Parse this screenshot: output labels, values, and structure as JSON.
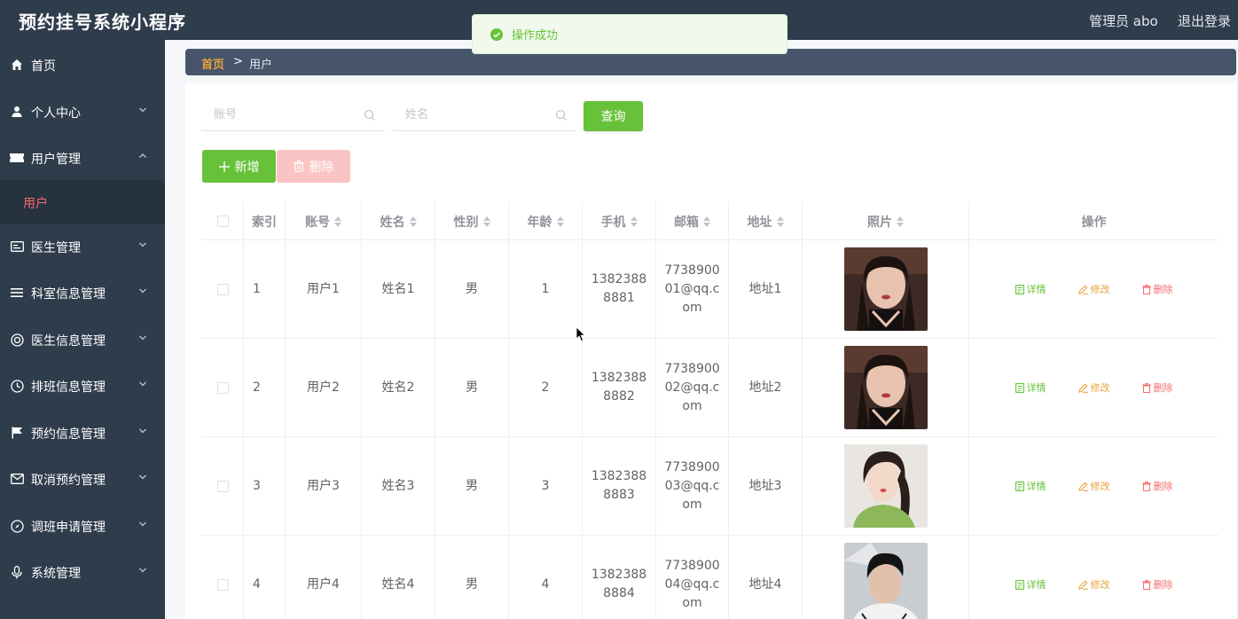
{
  "header": {
    "title": "预约挂号系统小程序",
    "user": "管理员 abo",
    "logout": "退出登录"
  },
  "sidebar": {
    "items": [
      {
        "label": "首页",
        "icon": "home-icon"
      },
      {
        "label": "个人中心",
        "icon": "user-icon"
      },
      {
        "label": "用户管理",
        "icon": "ticket-icon"
      },
      {
        "label": "医生管理",
        "icon": "card-icon"
      },
      {
        "label": "科室信息管理",
        "icon": "list-icon"
      },
      {
        "label": "医生信息管理",
        "icon": "lifebuoy-icon"
      },
      {
        "label": "排班信息管理",
        "icon": "clock-icon"
      },
      {
        "label": "预约信息管理",
        "icon": "flag-icon"
      },
      {
        "label": "取消预约管理",
        "icon": "mail-icon"
      },
      {
        "label": "调班申请管理",
        "icon": "compass-icon"
      },
      {
        "label": "系统管理",
        "icon": "mic-icon"
      }
    ],
    "sub_item": "用户"
  },
  "breadcrumb": {
    "home": "首页",
    "separator": ">",
    "current": "用户"
  },
  "search": {
    "account_placeholder": "账号",
    "name_placeholder": "姓名",
    "query_label": "查询"
  },
  "actions": {
    "add_label": "新增",
    "delete_label": "删除"
  },
  "table": {
    "headers": {
      "index": "索引",
      "account": "账号",
      "name": "姓名",
      "gender": "性别",
      "age": "年龄",
      "phone": "手机",
      "email": "邮箱",
      "address": "地址",
      "photo": "照片",
      "ops": "操作"
    },
    "rows": [
      {
        "index": "1",
        "account": "用户1",
        "name": "姓名1",
        "gender": "男",
        "age": "1",
        "phone": "13823888881",
        "email": "773890001@qq.com",
        "address": "地址1",
        "photo": "photo-1"
      },
      {
        "index": "2",
        "account": "用户2",
        "name": "姓名2",
        "gender": "男",
        "age": "2",
        "phone": "13823888882",
        "email": "773890002@qq.com",
        "address": "地址2",
        "photo": "photo-2"
      },
      {
        "index": "3",
        "account": "用户3",
        "name": "姓名3",
        "gender": "男",
        "age": "3",
        "phone": "13823888883",
        "email": "773890003@qq.com",
        "address": "地址3",
        "photo": "photo-3"
      },
      {
        "index": "4",
        "account": "用户4",
        "name": "姓名4",
        "gender": "男",
        "age": "4",
        "phone": "13823888884",
        "email": "773890004@qq.com",
        "address": "地址4",
        "photo": "photo-4"
      }
    ],
    "op_labels": {
      "detail": "详情",
      "edit": "修改",
      "remove": "删除"
    }
  },
  "toast": {
    "message": "操作成功"
  },
  "colors": {
    "sidebar_bg": "#2f3c4c",
    "primary_green": "#67c23a",
    "danger_light": "#fbc4c4",
    "warning": "#e6a23c",
    "danger": "#f56c6c"
  }
}
